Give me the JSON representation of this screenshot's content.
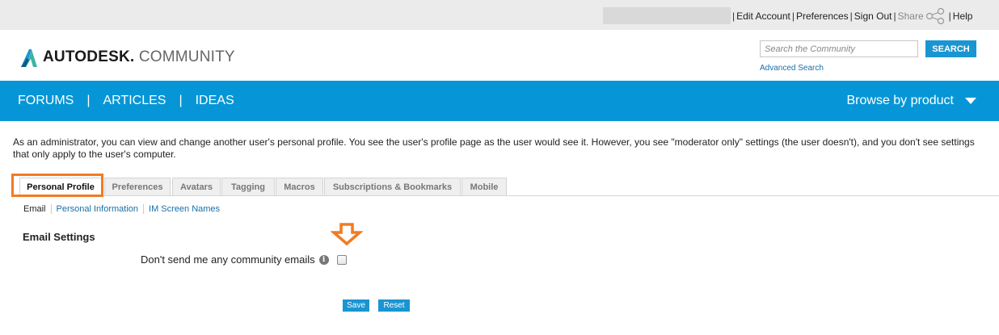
{
  "topbar": {
    "links": [
      "Edit Account",
      "Preferences",
      "Sign Out"
    ],
    "share_label": "Share",
    "help_label": "Help"
  },
  "header": {
    "logo_bold": "AUTODESK.",
    "logo_light": " COMMUNITY",
    "search_placeholder": "Search the Community",
    "search_button": "SEARCH",
    "advanced_search": "Advanced Search"
  },
  "nav": {
    "items": [
      "FORUMS",
      "ARTICLES",
      "IDEAS"
    ],
    "browse_label": "Browse by product"
  },
  "intro_text": "As an administrator, you can view and change another user's personal profile. You see the user's profile page as the user would see it. However, you see \"moderator only\" settings (the user doesn't), and you don't see settings that only apply to the user's computer.",
  "tabs": [
    "Personal Profile",
    "Preferences",
    "Avatars",
    "Tagging",
    "Macros",
    "Subscriptions & Bookmarks",
    "Mobile"
  ],
  "active_tab": "Personal Profile",
  "subtabs": {
    "current": "Email",
    "links": [
      "Personal Information",
      "IM Screen Names"
    ]
  },
  "email_settings": {
    "title": "Email Settings",
    "option_label": "Don't send me any community emails",
    "info_icon": "i",
    "checked": false
  },
  "buttons": {
    "save": "Save",
    "reset": "Reset"
  },
  "colors": {
    "nav_blue": "#0696d7",
    "button_blue": "#1a95d2",
    "highlight_orange": "#f47a20"
  }
}
